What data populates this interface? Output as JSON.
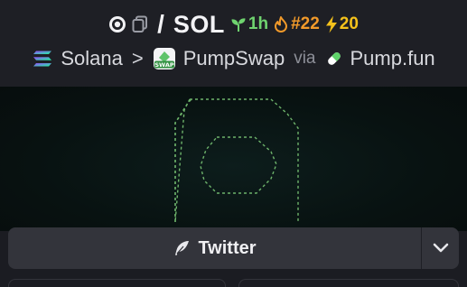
{
  "header": {
    "symbol": "SOL",
    "slash": "/",
    "age": "1h",
    "rank": "#22",
    "boosts": "20",
    "chain": "Solana",
    "separator": ">",
    "dex": "PumpSwap",
    "via_label": "via",
    "via_name": "Pump.fun"
  },
  "dex_logo_text": "SWAP",
  "actions": {
    "twitter_label": "Twitter"
  },
  "colors": {
    "age": "#6fd36f",
    "rank": "#f29a2a",
    "boost": "#f5c21b",
    "banner_stroke": "#7fcf7a"
  }
}
